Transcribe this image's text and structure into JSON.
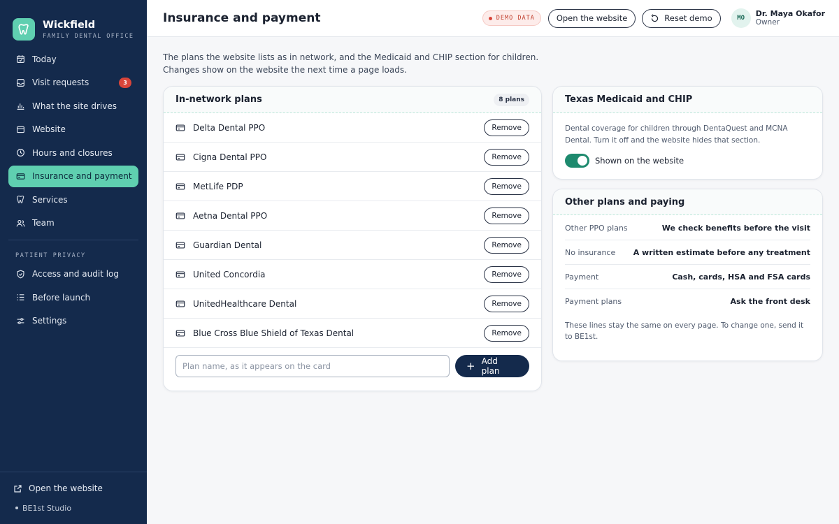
{
  "brand": {
    "name": "Wickfield",
    "subtitle": "FAMILY DENTAL OFFICE"
  },
  "sidebar": {
    "items": [
      {
        "label": "Today",
        "icon": "calendar-icon"
      },
      {
        "label": "Visit requests",
        "icon": "inbox-icon",
        "badge": "3"
      },
      {
        "label": "What the site drives",
        "icon": "bar-chart-icon"
      },
      {
        "label": "Website",
        "icon": "browser-icon"
      },
      {
        "label": "Hours and closures",
        "icon": "clock-icon"
      },
      {
        "label": "Insurance and payment",
        "icon": "card-icon",
        "active": true
      },
      {
        "label": "Services",
        "icon": "tooth-icon"
      },
      {
        "label": "Team",
        "icon": "users-icon"
      }
    ],
    "privacy_label": "PATIENT PRIVACY",
    "privacy_items": [
      {
        "label": "Access and audit log",
        "icon": "shield-icon"
      },
      {
        "label": "Before launch",
        "icon": "checklist-icon"
      },
      {
        "label": "Settings",
        "icon": "sliders-icon"
      }
    ],
    "open_site": "Open the website",
    "studio": "BE1st Studio"
  },
  "header": {
    "title": "Insurance and payment",
    "demo": "DEMO DATA",
    "open_site": "Open the website",
    "reset": "Reset demo",
    "user_initials": "MO",
    "user_name": "Dr. Maya Okafor",
    "user_role": "Owner"
  },
  "intro": {
    "line1": "The plans the website lists as in network, and the Medicaid and CHIP section for children.",
    "line2": "Changes show on the website the next time a page loads."
  },
  "plans": {
    "title": "In-network plans",
    "count": "8 plans",
    "remove_label": "Remove",
    "items": [
      "Delta Dental PPO",
      "Cigna Dental PPO",
      "MetLife PDP",
      "Aetna Dental PPO",
      "Guardian Dental",
      "United Concordia",
      "UnitedHealthcare Dental",
      "Blue Cross Blue Shield of Texas Dental"
    ],
    "input_placeholder": "Plan name, as it appears on the card",
    "input_value": "",
    "add_label": "Add plan"
  },
  "medicaid": {
    "title": "Texas Medicaid and CHIP",
    "description": "Dental coverage for children through DentaQuest and MCNA Dental. Turn it off and the website hides that section.",
    "toggle_label": "Shown on the website",
    "toggle_on": true
  },
  "other": {
    "title": "Other plans and paying",
    "rows": [
      {
        "key": "Other PPO plans",
        "value": "We check benefits before the visit"
      },
      {
        "key": "No insurance",
        "value": "A written estimate before any treatment"
      },
      {
        "key": "Payment",
        "value": "Cash, cards, HSA and FSA cards"
      },
      {
        "key": "Payment plans",
        "value": "Ask the front desk"
      }
    ],
    "note": "These lines stay the same on every page. To change one, send it to BE1st."
  },
  "colors": {
    "sidebar": "#142a4c",
    "accent": "#5fcfb0",
    "toggle": "#1e8a6e",
    "badge": "#d9453a"
  }
}
